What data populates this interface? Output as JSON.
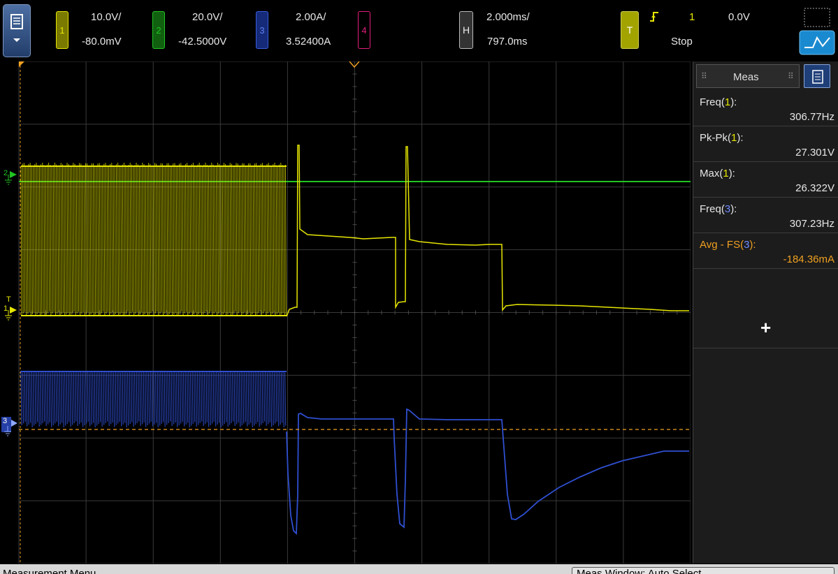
{
  "toolbar": {
    "ch1": {
      "label": "1",
      "scale": "10.0V/",
      "offset": "-80.0mV",
      "color": "#e6e600"
    },
    "ch2": {
      "label": "2",
      "scale": "20.0V/",
      "offset": "-42.5000V",
      "color": "#21c421"
    },
    "ch3": {
      "label": "3",
      "scale": "2.00A/",
      "offset": "3.52400A",
      "color": "#2f4fd0"
    },
    "ch4": {
      "label": "4",
      "color": "#e0207a"
    },
    "horizontal": {
      "label": "H",
      "scale": "2.000ms/",
      "delay": "797.0ms"
    },
    "trigger": {
      "label": "T",
      "source": "1",
      "level": "0.0V",
      "state": "Stop",
      "edge_icon": "rising-edge-icon"
    }
  },
  "markers": {
    "ch2": "2",
    "ch1": "1",
    "trig": "T",
    "ch3": "3"
  },
  "measurements": {
    "tab_label": "Meas",
    "items": [
      {
        "name": "Freq(",
        "channel": "1",
        "close": "):",
        "value": "306.77Hz",
        "highlight": false
      },
      {
        "name": "Pk-Pk(",
        "channel": "1",
        "close": "):",
        "value": "27.301V",
        "highlight": false
      },
      {
        "name": "Max(",
        "channel": "1",
        "close": "):",
        "value": "26.322V",
        "highlight": false
      },
      {
        "name": "Freq(",
        "channel": "3",
        "close": "):",
        "value": "307.23Hz",
        "highlight": false
      },
      {
        "name": "Avg - FS(",
        "channel": "3",
        "close": "):",
        "value": "-184.36mA",
        "highlight": true
      }
    ],
    "add_label": "+"
  },
  "status": {
    "left": "Measurement Menu",
    "right": "Meas Window: Auto Select"
  },
  "colors": {
    "ch1": "#e6e600",
    "ch2": "#21c421",
    "ch3": "#2f4fd0",
    "accent": "#f0a020"
  }
}
